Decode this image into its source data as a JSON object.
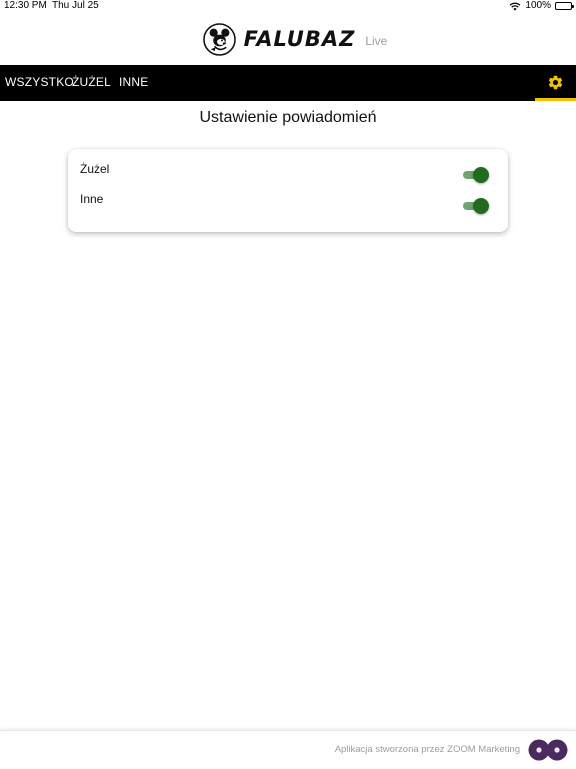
{
  "status_bar": {
    "time": "12:30 PM",
    "date": "Thu Jul 25",
    "battery": "100%"
  },
  "header": {
    "logo_text": "FALUBAZ",
    "logo_suffix": "Live"
  },
  "nav": {
    "tabs": [
      {
        "label": "WSZYSTKO"
      },
      {
        "label": "ŻUŻEL"
      },
      {
        "label": "INNE"
      }
    ],
    "settings_icon": "gear-icon",
    "active_color": "#f2c200"
  },
  "page": {
    "title": "Ustawienie powiadomień"
  },
  "settings": {
    "items": [
      {
        "label": "Żużel",
        "enabled": true
      },
      {
        "label": "Inne",
        "enabled": true
      }
    ],
    "switch_color": "#1f6b1f"
  },
  "footer": {
    "text": "Aplikacja stworzona przez ZOOM Marketing",
    "logo_icon": "zoom-logo-icon",
    "logo_color": "#4b2a5e"
  }
}
